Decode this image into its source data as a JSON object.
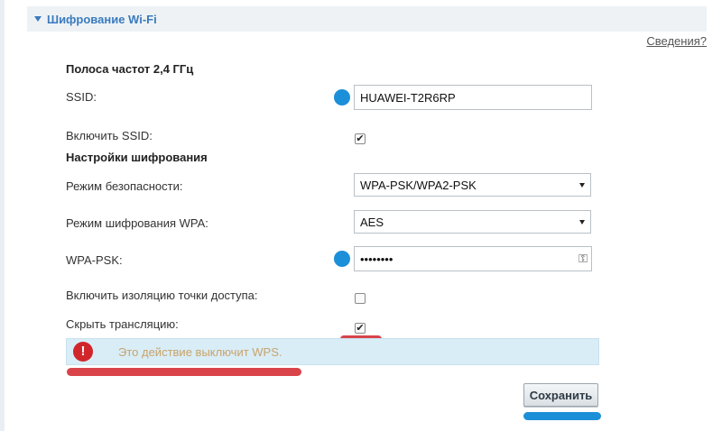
{
  "section": {
    "title": "Шифрование Wi-Fi",
    "help_link": "Сведения?"
  },
  "band": {
    "heading": "Полоса частот 2,4 ГГц"
  },
  "ssid": {
    "label": "SSID:",
    "value": "HUAWEI-T2R6RP"
  },
  "enable_ssid": {
    "label": "Включить SSID:",
    "checked": true
  },
  "encryption": {
    "heading": "Настройки шифрования",
    "security_mode": {
      "label": "Режим безопасности:",
      "value": "WPA-PSK/WPA2-PSK"
    },
    "wpa_mode": {
      "label": "Режим шифрования WPA:",
      "value": "AES"
    },
    "wpa_psk": {
      "label": "WPA-PSK:",
      "value": "••••••••"
    }
  },
  "ap_isolation": {
    "label": "Включить изоляцию точки доступа:",
    "checked": false
  },
  "hide_broadcast": {
    "label": "Скрыть трансляцию:",
    "checked": true
  },
  "warning": {
    "icon": "!",
    "text": "Это действие выключит WPS."
  },
  "save_button": {
    "label": "Сохранить"
  },
  "colors": {
    "accent_blue": "#1c8fd9",
    "highlight_red": "#d9434a",
    "header_text": "#3a7bbf"
  }
}
